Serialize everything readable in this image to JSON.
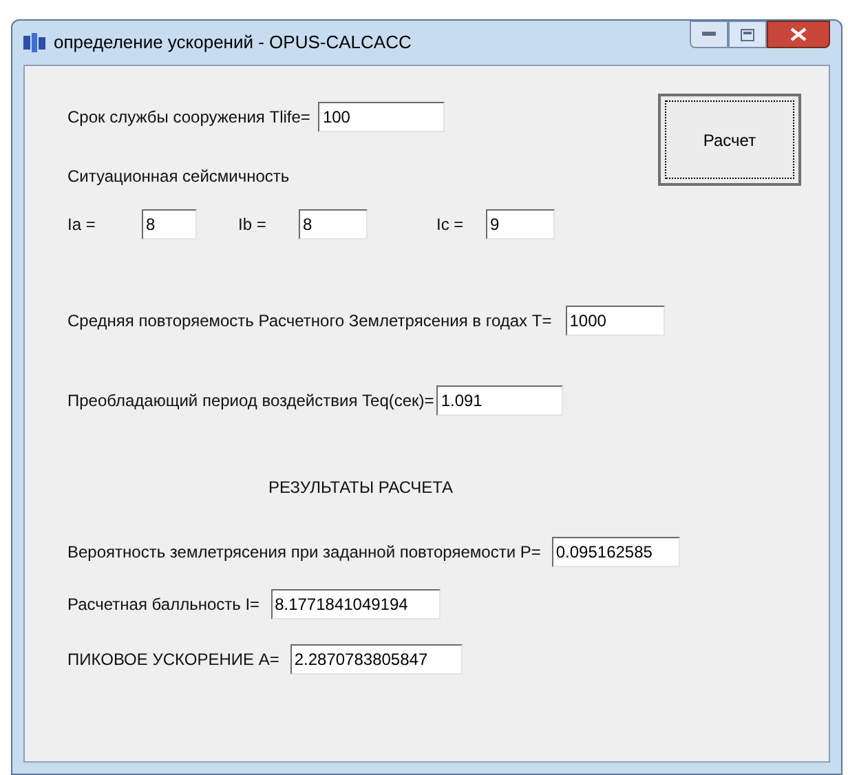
{
  "window": {
    "title": "определение ускорений - OPUS-CALCACC"
  },
  "service_life": {
    "label": "Срок службы сооружения Tlife=",
    "value": "100"
  },
  "calculate_button": {
    "label": "Расчет"
  },
  "seismicity": {
    "label": "Ситуационная сейсмичность",
    "fields": [
      {
        "label": "Ia =",
        "value": "8"
      },
      {
        "label": "Ib =",
        "value": "8"
      },
      {
        "label": "Ic =",
        "value": "9"
      }
    ]
  },
  "recurrence": {
    "label": "Средняя повторяемость Расчетного Землетрясения в годах T=",
    "value": "1000"
  },
  "period": {
    "label": "Преобладающий период воздействия Teq(сек)=",
    "value": "1.091"
  },
  "results": {
    "heading": "РЕЗУЛЬТАТЫ РАСЧЕТА",
    "rows": [
      {
        "label": "Вероятность землетрясения при заданной повторяемости P=",
        "value": "0.095162585"
      },
      {
        "label": "Расчетная балльность I=",
        "value": "8.1771841049194"
      },
      {
        "label": "ПИКОВОЕ УСКОРЕНИЕ A=",
        "value": "2.2870783805847"
      }
    ]
  }
}
